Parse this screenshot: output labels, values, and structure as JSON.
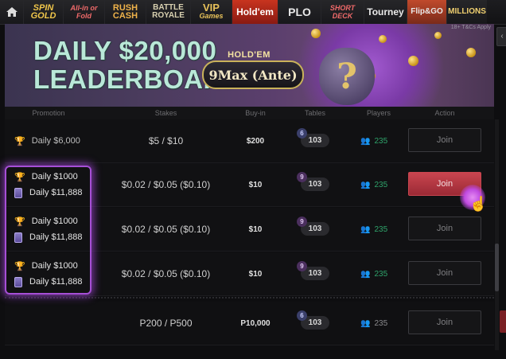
{
  "nav": {
    "tabs": [
      {
        "label": "SPIN GOLD",
        "small": "",
        "active": false
      },
      {
        "label": "All-in or Fold",
        "small": "",
        "active": false
      },
      {
        "label": "RUSH CASH",
        "small": "",
        "active": false
      },
      {
        "label": "BATTLE ROYALE",
        "small": "",
        "active": false
      },
      {
        "label": "VIP",
        "small": "Games",
        "active": false
      },
      {
        "label": "Hold'em",
        "small": "",
        "active": true
      },
      {
        "label": "PLO",
        "small": "",
        "active": false
      },
      {
        "label": "SHORT DECK",
        "small": "",
        "active": false
      },
      {
        "label": "Tourney",
        "small": "",
        "active": false
      },
      {
        "label": "Flip&GO",
        "small": "",
        "active": false
      },
      {
        "label": "MILLIONS",
        "small": "",
        "active": false
      }
    ]
  },
  "banner": {
    "title_line1": "DAILY $20,000",
    "title_line2": "LEADERBOARD",
    "holdem": "HOLD'EM",
    "pill": "9Max (Ante)",
    "question": "?",
    "tc": "18+ T&Cs Apply"
  },
  "table": {
    "headers": {
      "promotion": "Promotion",
      "stakes": "Stakes",
      "buyin": "Buy-in",
      "tables": "Tables",
      "players": "Players",
      "action": "Action"
    },
    "rows": [
      {
        "promo1": "Daily $6,000",
        "promo2": "",
        "stakes": "$5 / $10",
        "buyin": "$200",
        "badge": "6",
        "tables": "103",
        "players": "235",
        "action": "Join"
      },
      {
        "promo1": "Daily $1000",
        "promo2": "Daily $11,888",
        "stakes": "$0.02 / $0.05 ($0.10)",
        "buyin": "$10",
        "badge": "9",
        "tables": "103",
        "players": "235",
        "action": "Join"
      },
      {
        "promo1": "Daily $1000",
        "promo2": "Daily $11,888",
        "stakes": "$0.02 / $0.05 ($0.10)",
        "buyin": "$10",
        "badge": "9",
        "tables": "103",
        "players": "235",
        "action": "Join"
      },
      {
        "promo1": "Daily $1000",
        "promo2": "Daily $11,888",
        "stakes": "$0.02 / $0.05 ($0.10)",
        "buyin": "$10",
        "badge": "9",
        "tables": "103",
        "players": "235",
        "action": "Join"
      },
      {
        "promo1": "",
        "promo2": "",
        "stakes": "P200 / P500",
        "buyin": "P10,000",
        "badge": "6",
        "tables": "103",
        "players": "235",
        "action": "Join"
      }
    ]
  },
  "colors": {
    "accent": "#c9454f",
    "highlight": "#a64fd6",
    "players_green": "#2ea36a"
  }
}
